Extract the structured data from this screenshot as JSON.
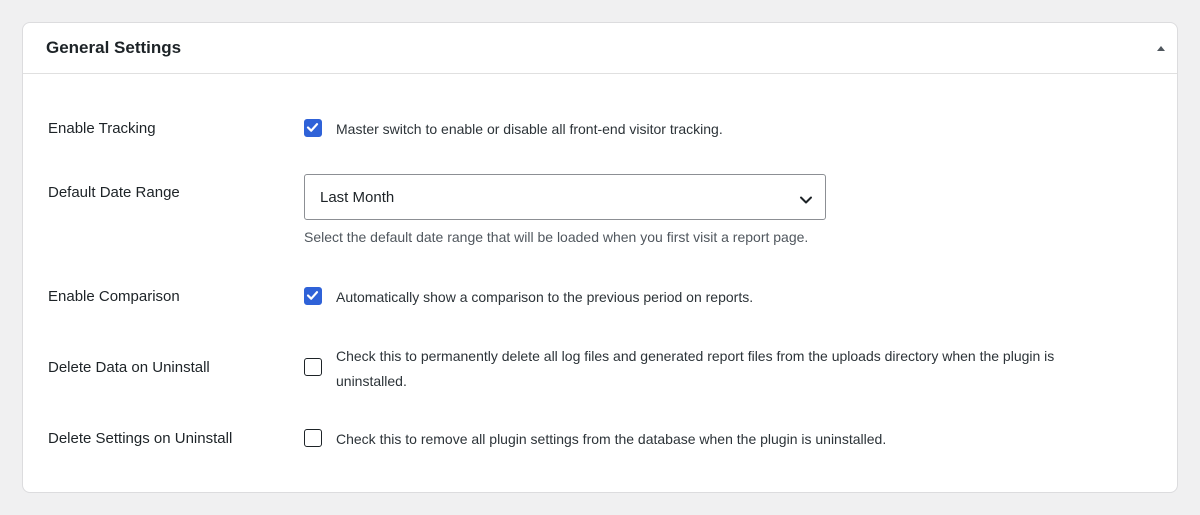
{
  "panel": {
    "title": "General Settings",
    "collapse_icon": "triangle-up-icon"
  },
  "settings": [
    {
      "label": "Enable Tracking",
      "type": "checkbox",
      "checked": true,
      "description": "Master switch to enable or disable all front-end visitor tracking."
    },
    {
      "label": "Default Date Range",
      "type": "select",
      "selected_value": "Last Month",
      "help": "Select the default date range that will be loaded when you first visit a report page."
    },
    {
      "label": "Enable Comparison",
      "type": "checkbox",
      "checked": true,
      "description": "Automatically show a comparison to the previous period on reports."
    },
    {
      "label": "Delete Data on Uninstall",
      "type": "checkbox",
      "checked": false,
      "description_line1": "Check this to permanently delete all log files and generated report files from the uploads directory when the plugin is",
      "description_line2": "uninstalled."
    },
    {
      "label": "Delete Settings on Uninstall",
      "type": "checkbox",
      "checked": false,
      "description": "Check this to remove all plugin settings from the database when the plugin is uninstalled."
    }
  ],
  "colors": {
    "checkbox_checked": "#2f62d8",
    "background": "#f0f0f1",
    "panel": "#ffffff"
  }
}
